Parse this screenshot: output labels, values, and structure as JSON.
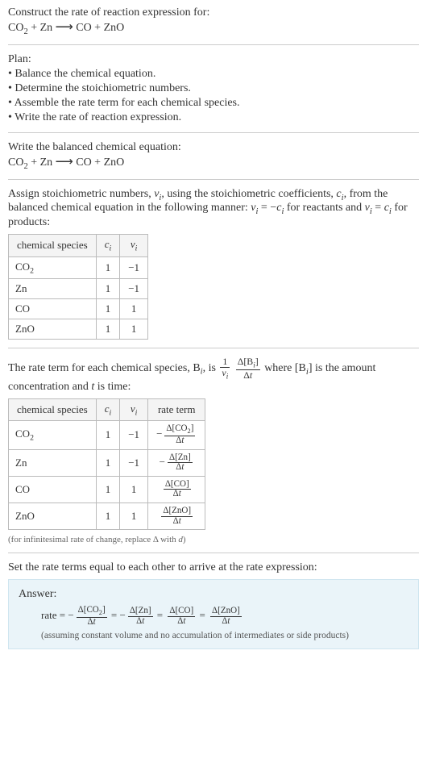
{
  "header": {
    "prompt": "Construct the rate of reaction expression for:",
    "equation_html": "CO<sub>2</sub> + Zn&nbsp;<span class='arrow'>⟶</span>&nbsp;CO + ZnO"
  },
  "plan": {
    "title": "Plan:",
    "items": [
      "• Balance the chemical equation.",
      "• Determine the stoichiometric numbers.",
      "• Assemble the rate term for each chemical species.",
      "• Write the rate of reaction expression."
    ]
  },
  "balanced": {
    "title": "Write the balanced chemical equation:",
    "equation_html": "CO<sub>2</sub> + Zn&nbsp;<span class='arrow'>⟶</span>&nbsp;CO + ZnO"
  },
  "stoich": {
    "intro_html": "Assign stoichiometric numbers, <span class='italic'>ν<sub>i</sub></span>, using the stoichiometric coefficients, <span class='italic'>c<sub>i</sub></span>, from the balanced chemical equation in the following manner: <span class='italic'>ν<sub>i</sub></span> = −<span class='italic'>c<sub>i</sub></span> for reactants and <span class='italic'>ν<sub>i</sub></span> = <span class='italic'>c<sub>i</sub></span> for products:",
    "headers": {
      "species": "chemical species",
      "c": "c",
      "nu": "ν"
    },
    "rows": [
      {
        "species_html": "CO<sub>2</sub>",
        "c": "1",
        "nu": "−1"
      },
      {
        "species_html": "Zn",
        "c": "1",
        "nu": "−1"
      },
      {
        "species_html": "CO",
        "c": "1",
        "nu": "1"
      },
      {
        "species_html": "ZnO",
        "c": "1",
        "nu": "1"
      }
    ]
  },
  "rateterm": {
    "intro_pre": "The rate term for each chemical species, B",
    "intro_mid": ", is ",
    "frac1_num": "1",
    "frac1_den_html": "<span class='italic'>ν<sub>i</sub></span>",
    "frac2_num_html": "Δ[B<sub><span class='italic'>i</span></sub>]",
    "frac2_den_html": "Δ<span class='italic'>t</span>",
    "intro_post_html": " where [B<sub><span class='italic'>i</span></sub>] is the amount concentration and <span class='italic'>t</span> is time:",
    "headers": {
      "species": "chemical species",
      "c": "c",
      "nu": "ν",
      "rate": "rate term"
    },
    "rows": [
      {
        "species_html": "CO<sub>2</sub>",
        "c": "1",
        "nu": "−1",
        "sign": "−",
        "num_html": "Δ[CO<sub>2</sub>]",
        "den_html": "Δ<span class='italic'>t</span>"
      },
      {
        "species_html": "Zn",
        "c": "1",
        "nu": "−1",
        "sign": "−",
        "num_html": "Δ[Zn]",
        "den_html": "Δ<span class='italic'>t</span>"
      },
      {
        "species_html": "CO",
        "c": "1",
        "nu": "1",
        "sign": "",
        "num_html": "Δ[CO]",
        "den_html": "Δ<span class='italic'>t</span>"
      },
      {
        "species_html": "ZnO",
        "c": "1",
        "nu": "1",
        "sign": "",
        "num_html": "Δ[ZnO]",
        "den_html": "Δ<span class='italic'>t</span>"
      }
    ],
    "note_html": "(for infinitesimal rate of change, replace Δ with <span class='italic'>d</span>)"
  },
  "final": {
    "title": "Set the rate terms equal to each other to arrive at the rate expression:",
    "answer_label": "Answer:",
    "rate_prefix": "rate = ",
    "terms": [
      {
        "sign": "−",
        "num_html": "Δ[CO<sub>2</sub>]",
        "den_html": "Δ<span class='italic'>t</span>"
      },
      {
        "sign": "−",
        "num_html": "Δ[Zn]",
        "den_html": "Δ<span class='italic'>t</span>"
      },
      {
        "sign": "",
        "num_html": "Δ[CO]",
        "den_html": "Δ<span class='italic'>t</span>"
      },
      {
        "sign": "",
        "num_html": "Δ[ZnO]",
        "den_html": "Δ<span class='italic'>t</span>"
      }
    ],
    "eq_sep": " = ",
    "assumption": "(assuming constant volume and no accumulation of intermediates or side products)"
  }
}
